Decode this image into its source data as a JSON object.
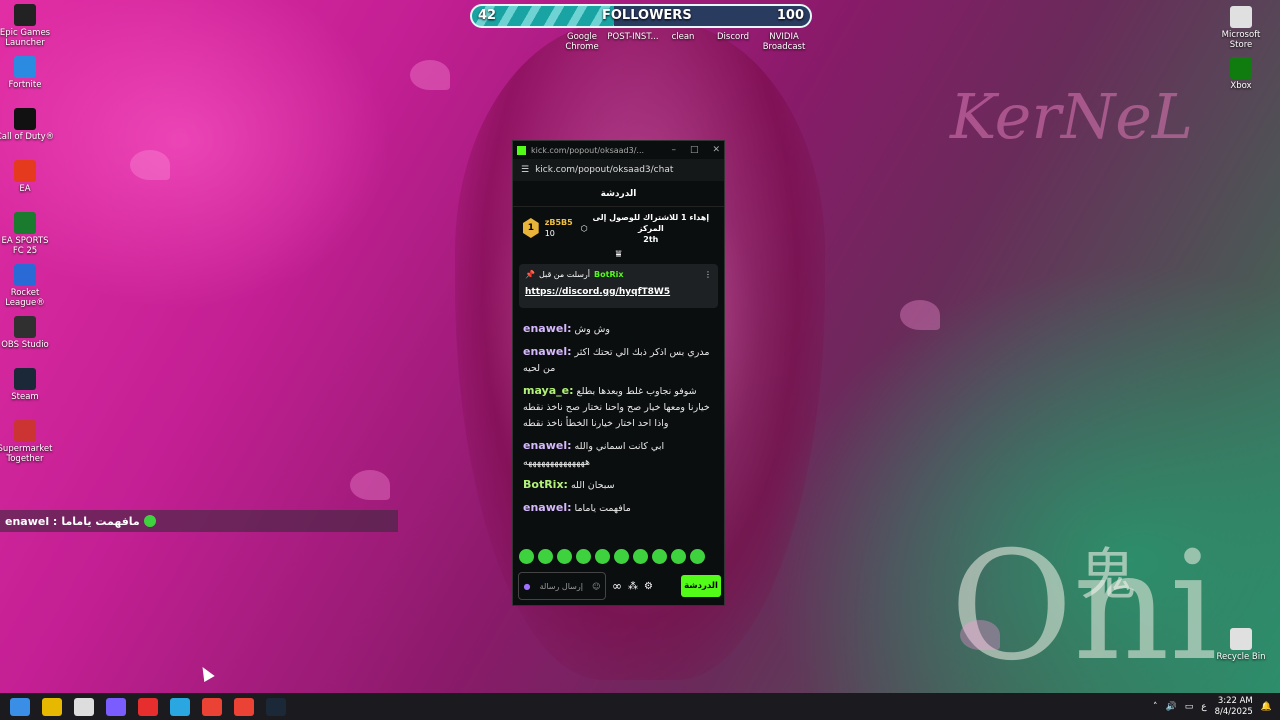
{
  "desktop_icons_left": [
    {
      "label": "Epic Games Launcher",
      "icon": "epic-icon",
      "color": "#222"
    },
    {
      "label": "Fortnite",
      "icon": "fortnite-icon",
      "color": "#2a8be0"
    },
    {
      "label": "Call of Duty®",
      "icon": "cod-icon",
      "color": "#111"
    },
    {
      "label": "EA",
      "icon": "ea-icon",
      "color": "#e63a1e"
    },
    {
      "label": "EA SPORTS FC 25",
      "icon": "fc25-icon",
      "color": "#1a7a2e"
    },
    {
      "label": "Rocket League®",
      "icon": "rocket-league-icon",
      "color": "#2a6ad6"
    },
    {
      "label": "OBS Studio",
      "icon": "obs-icon",
      "color": "#303030"
    },
    {
      "label": "Steam",
      "icon": "steam-icon",
      "color": "#1b2838"
    },
    {
      "label": "Supermarket Together",
      "icon": "supermarket-icon",
      "color": "#c33"
    }
  ],
  "desktop_icons_right": [
    {
      "label": "Microsoft Store",
      "icon": "ms-store-icon"
    },
    {
      "label": "Xbox",
      "icon": "xbox-icon"
    },
    {
      "label": "Recycle Bin",
      "icon": "recycle-bin-icon"
    }
  ],
  "top_icons": [
    {
      "label": "Google Chrome",
      "icon": "chrome-icon"
    },
    {
      "label": "POST-INST...",
      "icon": "folder-icon"
    },
    {
      "label": "clean",
      "icon": "folder-icon"
    },
    {
      "label": "Discord",
      "icon": "discord-icon"
    },
    {
      "label": "NVIDIA Broadcast",
      "icon": "nvidia-icon"
    }
  ],
  "followers": {
    "current": "42",
    "goal": "100",
    "label": "FOLLOWERS",
    "progress": 0.42
  },
  "kick": {
    "window_title": "kick.com/popout/oksaad3/...",
    "url": "kick.com/popout/oksaad3/chat",
    "header": "الدردشة",
    "leaderboard": {
      "rank": "1",
      "user": "zB5B5",
      "count": "10",
      "gift_text": "إهداء 1 للاشتراك للوصول إلى المركز",
      "place": "2th"
    },
    "pinned": {
      "sender": "BotRix",
      "prefix": "أرسلت من قبل",
      "link": "https://discord.gg/hyqfT8W5"
    },
    "messages": [
      {
        "user": "enawel:",
        "text": "وش وش"
      },
      {
        "user": "enawel:",
        "text": "مدري بس اذكر ذبك الي تحتك اكثر من لحيه"
      },
      {
        "user": "maya_e:",
        "text": "شوفو نجاوب غلط وبعدها بطلع خيارنا ومعها خيار صح واحنا نختار صح ناخذ نقطه واذا احد اختار خيارنا الخطأ ناخذ نقطه"
      },
      {
        "user": "enawel:",
        "text": "ابي كانت اسماني والله ههههههههههههههه"
      },
      {
        "user": "BotRix:",
        "text": "سبحان الله"
      },
      {
        "user": "enawel:",
        "text": "مافهمت ياماما"
      }
    ],
    "input_placeholder": "إرسال رسالة",
    "send_label": "الدردشة"
  },
  "overlay_chat": {
    "user": "enawel :",
    "text": "مافهمت ياماما"
  },
  "taskbar": {
    "apps": [
      "start-icon",
      "file-explorer-icon",
      "calendar-icon",
      "app-icon",
      "youtube-icon",
      "telegram-icon",
      "chrome-icon",
      "chrome-icon",
      "steam-icon"
    ],
    "lang": "ع",
    "time": "3:22 AM",
    "date": "8/4/2025"
  }
}
